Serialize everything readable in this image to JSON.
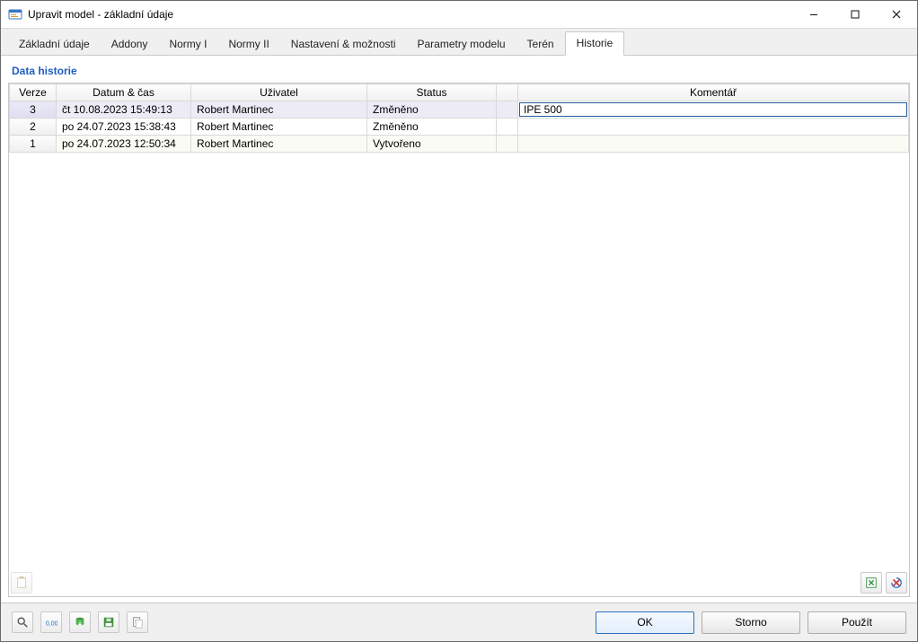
{
  "window": {
    "title": "Upravit model - základní údaje"
  },
  "tabs": [
    {
      "label": "Základní údaje"
    },
    {
      "label": "Addony"
    },
    {
      "label": "Normy I"
    },
    {
      "label": "Normy II"
    },
    {
      "label": "Nastavení & možnosti"
    },
    {
      "label": "Parametry modelu"
    },
    {
      "label": "Terén"
    },
    {
      "label": "Historie"
    }
  ],
  "tabs_active_index": 7,
  "panel_title": "Data historie",
  "columns": {
    "version": "Verze",
    "datetime": "Datum & čas",
    "user": "Uživatel",
    "status": "Status",
    "comment": "Komentář"
  },
  "rows": [
    {
      "version": "3",
      "datetime": "čt 10.08.2023 15:49:13",
      "user": "Robert Martinec",
      "status": "Změněno",
      "comment": "IPE 500"
    },
    {
      "version": "2",
      "datetime": "po 24.07.2023 15:38:43",
      "user": "Robert Martinec",
      "status": "Změněno",
      "comment": ""
    },
    {
      "version": "1",
      "datetime": "po 24.07.2023 12:50:34",
      "user": "Robert Martinec",
      "status": "Vytvořeno",
      "comment": ""
    }
  ],
  "buttons": {
    "ok": "OK",
    "cancel": "Storno",
    "apply": "Použít"
  },
  "icons": {
    "export": "export-icon",
    "reset_red": "reset-icon",
    "note": "note-clip-icon",
    "search": "search-icon",
    "units": "units-icon",
    "db": "database-arrow-icon",
    "save": "disk-save-icon",
    "list": "list-copy-icon"
  }
}
